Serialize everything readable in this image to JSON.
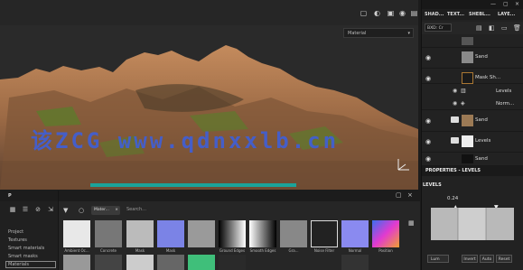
{
  "viewport": {
    "display_select": "Material",
    "watermark": "该ZCG www.qdnxxlb.cn"
  },
  "right_panel": {
    "tabs": [
      {
        "label": "SHAD..."
      },
      {
        "label": "TEXT..."
      },
      {
        "label": "SHEBL..."
      },
      {
        "label": "LAYE..."
      }
    ],
    "blend_mode": "BXD: Cr",
    "layers": [
      {
        "label": "",
        "kind": "top"
      },
      {
        "label": "Sand",
        "kind": "fill"
      },
      {
        "label": "Mask Sh...",
        "kind": "mask"
      },
      {
        "label": "Levels",
        "kind": "effect"
      },
      {
        "label": "Norm...",
        "kind": "effect"
      },
      {
        "label": "Sand",
        "kind": "folder"
      },
      {
        "label": "Levels",
        "kind": "folder"
      },
      {
        "label": "Sand",
        "kind": "fill"
      }
    ],
    "properties_title": "PROPERTIES - LEVELS",
    "levels_label": "LEVELS",
    "levels_value": "0.24",
    "mode_select": "Lum",
    "buttons": [
      "Invert",
      "Auto",
      "Reset"
    ]
  },
  "left_panel": {
    "title": "P",
    "items": [
      "Project",
      "Textures",
      "Smart materials",
      "Smart masks",
      "Materials"
    ]
  },
  "shelf": {
    "filter_chip": "Mater...",
    "search_placeholder": "Search...",
    "tiles": [
      {
        "label": "Ambient Oc..."
      },
      {
        "label": "Concrete"
      },
      {
        "label": "Mask"
      },
      {
        "label": "Mask"
      },
      {
        "label": ""
      },
      {
        "label": "Ground Edges"
      },
      {
        "label": "Smooth Edges"
      },
      {
        "label": "Gra..."
      },
      {
        "label": "Noise Filter"
      },
      {
        "label": "Normal"
      },
      {
        "label": "Position"
      }
    ]
  },
  "colors": {
    "accent": "#1aa39a",
    "watermark": "#3f5fd8",
    "terrain_rock": "#9c6a45",
    "terrain_moss": "#5e7a2c"
  }
}
